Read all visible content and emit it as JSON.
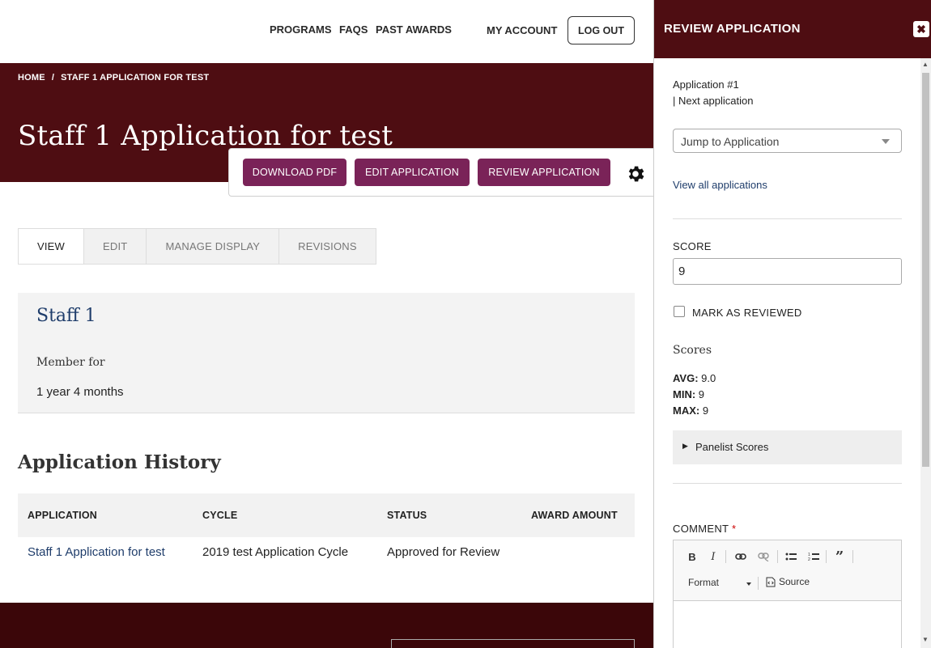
{
  "header": {
    "nav": [
      "PROGRAMS",
      "FAQS",
      "PAST AWARDS"
    ],
    "my_account": "MY ACCOUNT",
    "logout": "LOG OUT"
  },
  "breadcrumb": {
    "home": "HOME",
    "separator": "/",
    "current": "STAFF 1 APPLICATION FOR TEST"
  },
  "page": {
    "title": "Staff 1 Application for test"
  },
  "actions": {
    "download_pdf": "DOWNLOAD PDF",
    "edit_application": "EDIT APPLICATION",
    "review_application": "REVIEW APPLICATION"
  },
  "tabs": [
    "VIEW",
    "EDIT",
    "MANAGE DISPLAY",
    "REVISIONS"
  ],
  "profile": {
    "name": "Staff 1",
    "member_label": "Member for",
    "member_value": "1 year 4 months"
  },
  "history": {
    "title": "Application History",
    "columns": [
      "APPLICATION",
      "CYCLE",
      "STATUS",
      "AWARD AMOUNT"
    ],
    "rows": [
      {
        "application": "Staff 1 Application for test",
        "cycle": "2019 test Application Cycle",
        "status": "Approved for Review",
        "award": ""
      }
    ]
  },
  "panel": {
    "title": "REVIEW APPLICATION",
    "close": "✖",
    "application_number": "Application #1",
    "next_application": "| Next application",
    "jump_placeholder": "Jump to Application",
    "view_all": "View all applications",
    "score_label": "SCORE",
    "score_value": "9",
    "mark_reviewed": "MARK AS REVIEWED",
    "scores_title": "Scores",
    "stats": {
      "avg_label": "AVG:",
      "avg_value": "9.0",
      "min_label": "MIN:",
      "min_value": "9",
      "max_label": "MAX:",
      "max_value": "9"
    },
    "panelist_scores": "Panelist Scores",
    "comment_label": "COMMENT",
    "comment_required": "*",
    "editor": {
      "format": "Format",
      "source": "Source"
    }
  },
  "colors": {
    "maroon": "#4e0d12",
    "button_purple": "#7a2358",
    "link_blue": "#1f3d6b"
  }
}
